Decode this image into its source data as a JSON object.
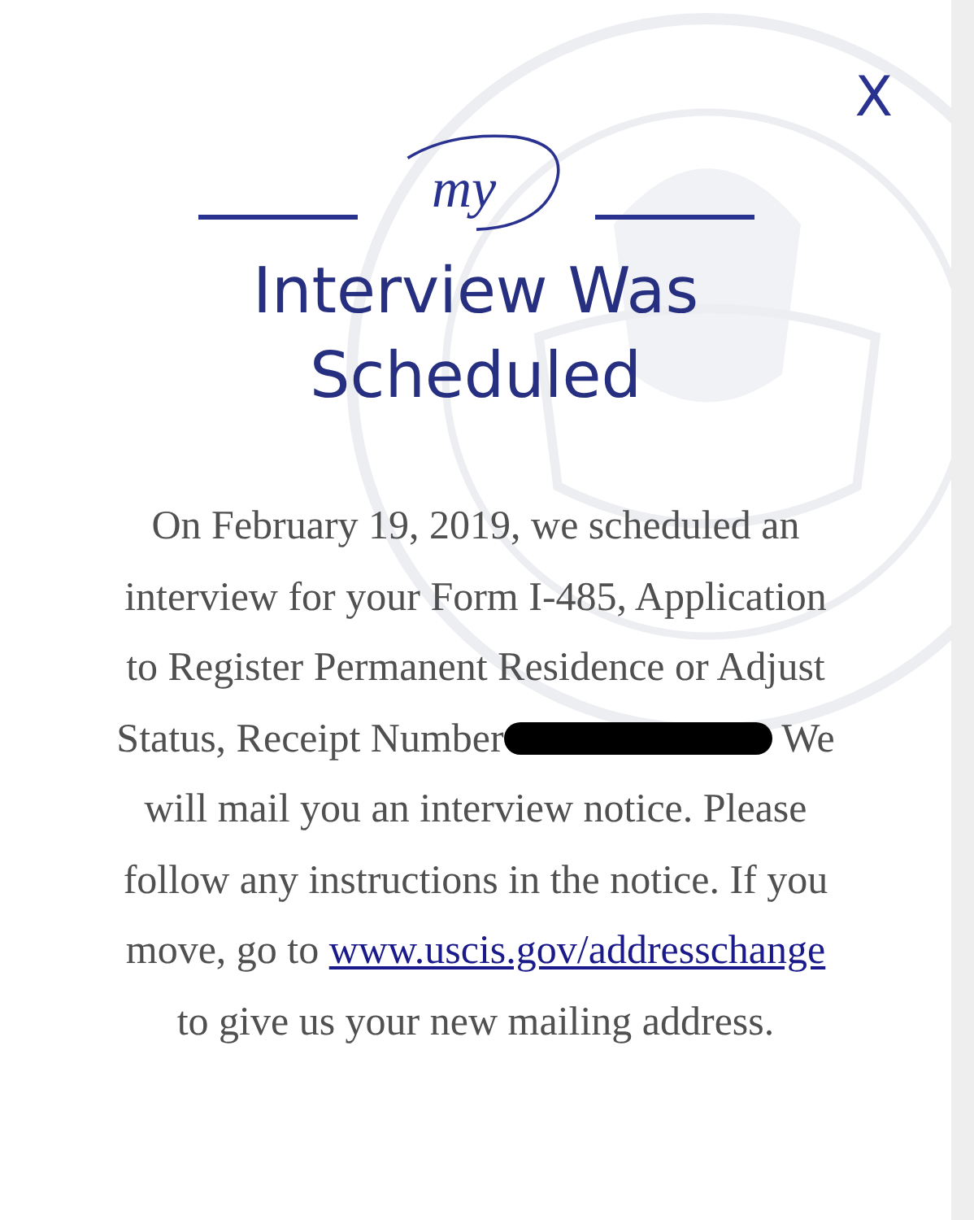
{
  "close_button": "X",
  "logo": {
    "text": "my"
  },
  "title": "Interview Was Scheduled",
  "message": {
    "before_redaction": "On February 19, 2019, we scheduled an interview for your Form I-485, Application to Register Permanent Residence or Adjust Status, Receipt Number",
    "redacted": true,
    "after_redaction": "We will mail you an interview notice. Please follow any instructions in the notice. If you move, go to",
    "link": "www.uscis.gov/addresschange",
    "after_link": "to give us your new mailing address."
  }
}
